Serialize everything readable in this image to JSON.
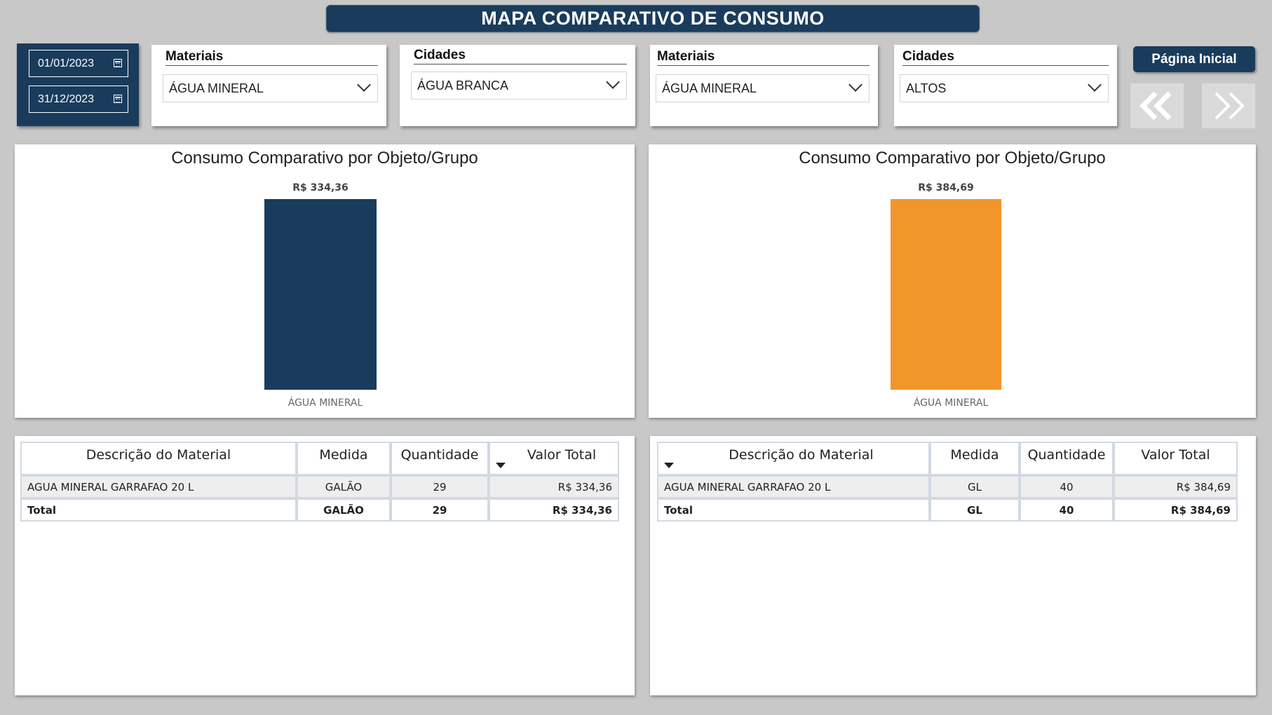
{
  "header": {
    "title": "MAPA COMPARATIVO DE CONSUMO"
  },
  "dates": {
    "start": "01/01/2023",
    "end": "31/12/2023"
  },
  "slicers": [
    {
      "title": "Materiais",
      "value": "ÁGUA MINERAL"
    },
    {
      "title": "Cidades",
      "value": "ÁGUA BRANCA"
    },
    {
      "title": "Materiais",
      "value": "ÁGUA MINERAL"
    },
    {
      "title": "Cidades",
      "value": "ALTOS"
    }
  ],
  "nav": {
    "home_label": "Página Inicial",
    "back_icon": "double-chevron-left-icon",
    "forward_icon": "double-chevron-right-icon"
  },
  "chart_data": [
    {
      "type": "bar",
      "title": "Consumo Comparativo por Objeto/Grupo",
      "categories": [
        "ÁGUA MINERAL"
      ],
      "values": [
        334.36
      ],
      "value_labels": [
        "R$ 334,36"
      ],
      "color": "#1a3c5c"
    },
    {
      "type": "bar",
      "title": "Consumo Comparativo por Objeto/Grupo",
      "categories": [
        "ÁGUA MINERAL"
      ],
      "values": [
        384.69
      ],
      "value_labels": [
        "R$ 384,69"
      ],
      "color": "#f0962a"
    }
  ],
  "tables": [
    {
      "columns": [
        "Descrição do Material",
        "Medida",
        "Quantidade",
        "Valor Total"
      ],
      "rows": [
        {
          "descricao": "AGUA MINERAL GARRAFAO 20 L",
          "medida": "GALÃO",
          "quantidade": "29",
          "valor": "R$ 334,36"
        }
      ],
      "total": {
        "label": "Total",
        "medida": "GALÃO",
        "quantidade": "29",
        "valor": "R$ 334,36"
      }
    },
    {
      "columns": [
        "Descrição do Material",
        "Medida",
        "Quantidade",
        "Valor Total"
      ],
      "rows": [
        {
          "descricao": "AGUA MINERAL GARRAFAO 20 L",
          "medida": "GL",
          "quantidade": "40",
          "valor": "R$ 384,69"
        }
      ],
      "total": {
        "label": "Total",
        "medida": "GL",
        "quantidade": "40",
        "valor": "R$ 384,69"
      }
    }
  ]
}
